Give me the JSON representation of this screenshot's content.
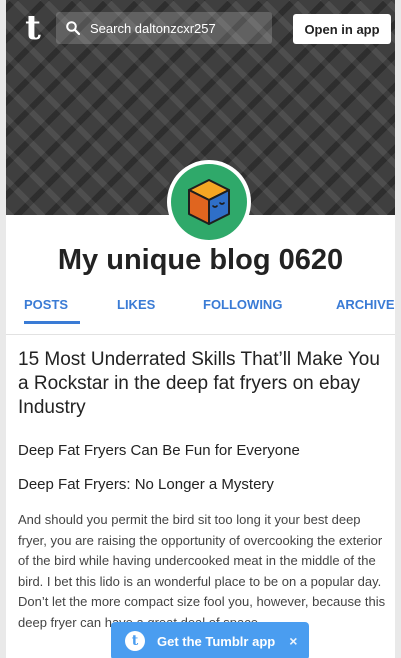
{
  "header": {
    "logo_text": "t",
    "search_placeholder": "Search daltonzcxr257",
    "open_app_label": "Open in app"
  },
  "blog": {
    "title": "My unique blog 0620"
  },
  "tabs": [
    {
      "label": "POSTS",
      "active": true
    },
    {
      "label": "LIKES",
      "active": false
    },
    {
      "label": "FOLLOWING",
      "active": false
    },
    {
      "label": "ARCHIVE",
      "active": false
    }
  ],
  "post": {
    "title": "15 Most Underrated Skills That’ll Make You a Rockstar in the deep fat fryers on ebay Industry",
    "subheading_1": "Deep Fat Fryers Can Be Fun for Everyone",
    "subheading_2": "Deep Fat Fryers: No Longer a Mystery",
    "body": "And should you permit the bird sit too long it your best deep fryer, you are raising the opportunity of overcooking the exterior of the bird while having undercooked meat in the middle of the bird. I bet this lido is an wonderful place to be on a popular day. Don’t let the more compact size fool you, however, because this deep fryer can have a great deal of space."
  },
  "app_banner": {
    "logo_text": "t",
    "label": "Get the Tumblr app",
    "close_symbol": "×"
  },
  "colors": {
    "accent": "#3a7bd5",
    "banner_button": "#4a9df0",
    "avatar_bg": "#2fa96a",
    "header_bg": "#3f3f3f"
  },
  "icons": {
    "search": "search-icon",
    "avatar": "orange-cube-icon"
  }
}
